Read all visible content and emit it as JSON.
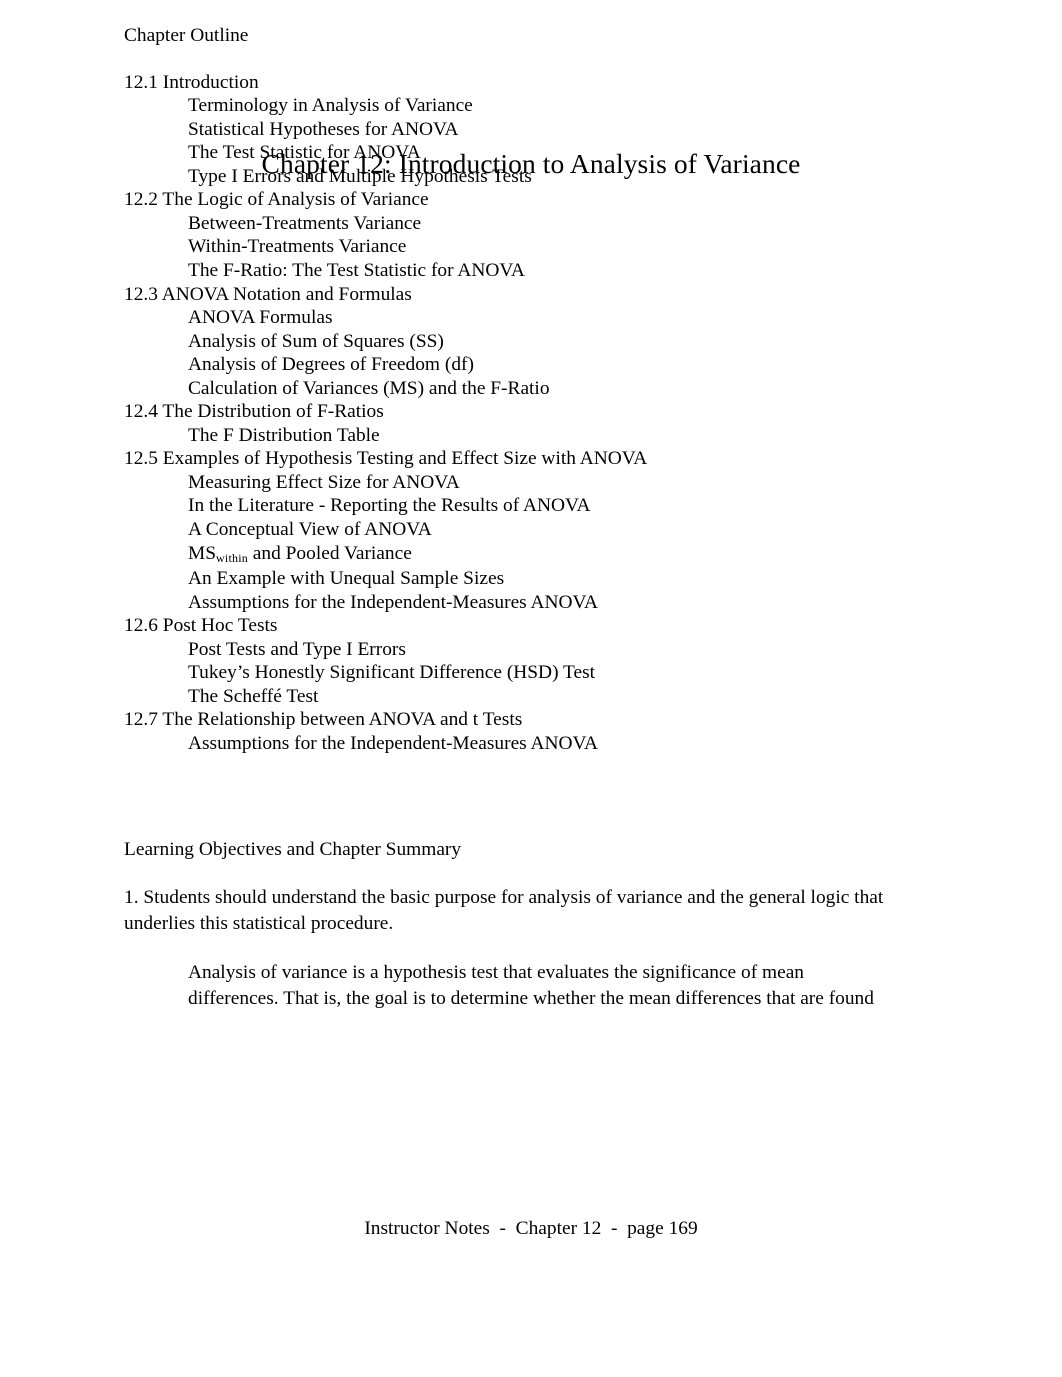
{
  "document": {
    "title": "Chapter 12: Introduction to Analysis of Variance",
    "outline_heading": "Chapter Outline",
    "summary_heading": "Learning Objectives and Chapter Summary"
  },
  "outline": {
    "items": [
      {
        "level": 1,
        "text": "12.1 Introduction"
      },
      {
        "level": 2,
        "text": "Terminology in Analysis of Variance"
      },
      {
        "level": 2,
        "text": "Statistical Hypotheses for ANOVA"
      },
      {
        "level": 2,
        "text": "The Test Statistic for ANOVA"
      },
      {
        "level": 2,
        "text": "Type I Errors and Multiple Hypothesis Tests"
      },
      {
        "level": 1,
        "text": "12.2 The Logic of Analysis of Variance"
      },
      {
        "level": 2,
        "text": "Between-Treatments Variance"
      },
      {
        "level": 2,
        "text": "Within-Treatments Variance"
      },
      {
        "level": 2,
        "text": "The F-Ratio: The Test Statistic for ANOVA"
      },
      {
        "level": 1,
        "text": "12.3 ANOVA Notation and Formulas"
      },
      {
        "level": 2,
        "text": "ANOVA Formulas"
      },
      {
        "level": 2,
        "text": "Analysis of Sum of Squares (SS)"
      },
      {
        "level": 2,
        "text": "Analysis of Degrees of Freedom (df)"
      },
      {
        "level": 2,
        "text": "Calculation of Variances (MS) and the F-Ratio"
      },
      {
        "level": 1,
        "text": "12.4 The Distribution of F-Ratios"
      },
      {
        "level": 2,
        "text": "The F Distribution Table"
      },
      {
        "level": 1,
        "text": "12.5 Examples of Hypothesis Testing and Effect Size with ANOVA"
      },
      {
        "level": 2,
        "text": "Measuring Effect Size for ANOVA"
      },
      {
        "level": 2,
        "text": "In the Literature - Reporting the Results of ANOVA"
      },
      {
        "level": 2,
        "text": "A Conceptual View of ANOVA"
      },
      {
        "level": 2,
        "text": "MS",
        "subscript": "within",
        "text_after": " and Pooled Variance"
      },
      {
        "level": 2,
        "text": "An Example with Unequal Sample Sizes"
      },
      {
        "level": 2,
        "text": "Assumptions for the Independent-Measures ANOVA"
      },
      {
        "level": 1,
        "text": "12.6 Post Hoc Tests"
      },
      {
        "level": 2,
        "text": "Post Tests and Type I Errors"
      },
      {
        "level": 2,
        "text": "Tukey’s Honestly Significant Difference (HSD) Test"
      },
      {
        "level": 2,
        "text": "The Scheffé Test"
      },
      {
        "level": 1,
        "text": "12.7 The Relationship between ANOVA and t Tests"
      },
      {
        "level": 2,
        "text": "Assumptions for the Independent-Measures ANOVA"
      }
    ]
  },
  "summary": {
    "objective_1": "1.  Students should understand the basic purpose for analysis of variance and the general logic that underlies this statistical procedure.",
    "objective_1_body": "Analysis of variance is a hypothesis test that evaluates the significance of mean differences.  That is, the goal is to determine whether the mean differences that are found"
  },
  "footer": {
    "text": "Instructor Notes  -  Chapter 12  -  page 169"
  }
}
